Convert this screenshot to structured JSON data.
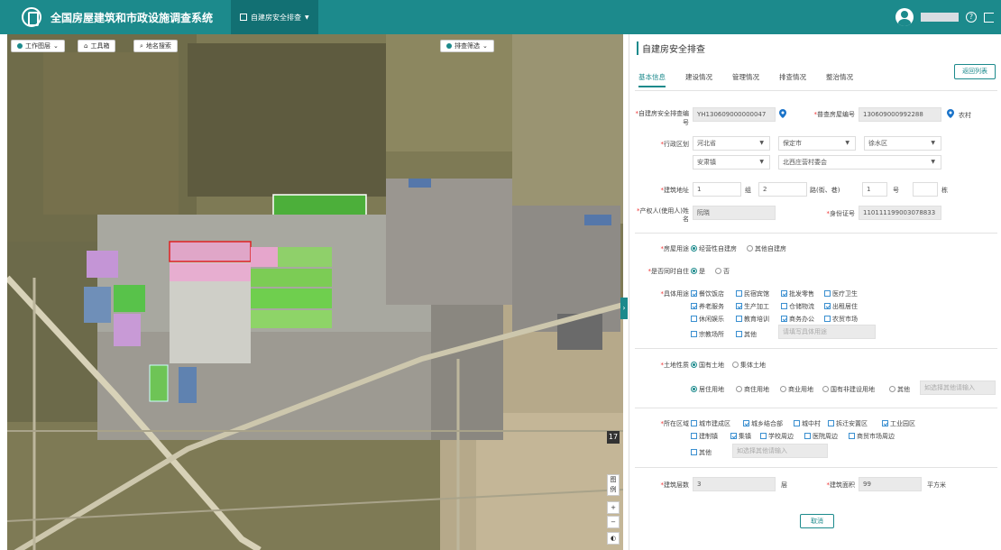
{
  "app": {
    "title": "全国房屋建筑和市政设施调查系统",
    "module": "自建房安全排查"
  },
  "map": {
    "layers_btn": "工作图层",
    "toolbox_btn": "工具箱",
    "search_btn": "地名搜索",
    "filter_btn": "排查筛选",
    "zoom_level": "17",
    "legend_btn": "图例",
    "zoom_in": "+",
    "zoom_out": "−"
  },
  "panel": {
    "title": "自建房安全排查",
    "return_btn": "返回列表",
    "tabs": [
      "基本信息",
      "建设情况",
      "管理情况",
      "排查情况",
      "整治情况"
    ],
    "id_label": "自建房安全排查编号",
    "id_value": "YH130609000000047",
    "census_label": "普查房屋编号",
    "census_value": "130609000992288",
    "rural_label": "农村",
    "region_label": "行政区划",
    "province": "河北省",
    "city": "保定市",
    "district": "徐水区",
    "town": "安肃镇",
    "village": "北西庄营村委会",
    "address_label": "建筑地址",
    "addr_v1": "1",
    "addr_u1": "组",
    "addr_v2": "2",
    "addr_u2": "路(街、巷)",
    "addr_v3": "1",
    "addr_u3": "号",
    "addr_u4": "栋",
    "owner_label": "产权人(使用人)姓名",
    "owner_value": "阮晓",
    "idcard_label": "身份证号",
    "idcard_value": "110111199003078833",
    "use_label": "房屋用途",
    "use_opt1": "经营性自建房",
    "use_opt2": "其他自建房",
    "live_label": "是否同时自住",
    "live_yes": "是",
    "live_no": "否",
    "detail_label": "具体用途",
    "detail_opts": [
      "餐饮饭店",
      "民宿宾馆",
      "批发零售",
      "医疗卫生",
      "养老服务",
      "生产加工",
      "仓储物流",
      "出租居住",
      "休闲娱乐",
      "教育培训",
      "商务办公",
      "农贸市场",
      "宗教场所",
      "其他"
    ],
    "detail_other_ph": "请填写具体用途",
    "land_label": "土地性质",
    "land_opt1": "国有土地",
    "land_opt2": "集体土地",
    "land_sub": [
      "居住用地",
      "商住用地",
      "商业用地",
      "国有非建设用地",
      "其他"
    ],
    "land_other_ph": "如选择其他请输入",
    "area_label": "所在区域",
    "area_opts": [
      "城市建成区",
      "城乡结合部",
      "城中村",
      "拆迁安置区",
      "工业园区",
      "建制镇",
      "集镇",
      "学校周边",
      "医院周边",
      "商贸市场周边",
      "其他"
    ],
    "area_other_ph": "如选择其他请输入",
    "floors_label": "建筑层数",
    "floors_value": "3",
    "floors_unit": "层",
    "build_area_label": "建筑面积",
    "build_area_value": "99",
    "build_area_unit": "平方米",
    "cancel_btn": "取消"
  }
}
